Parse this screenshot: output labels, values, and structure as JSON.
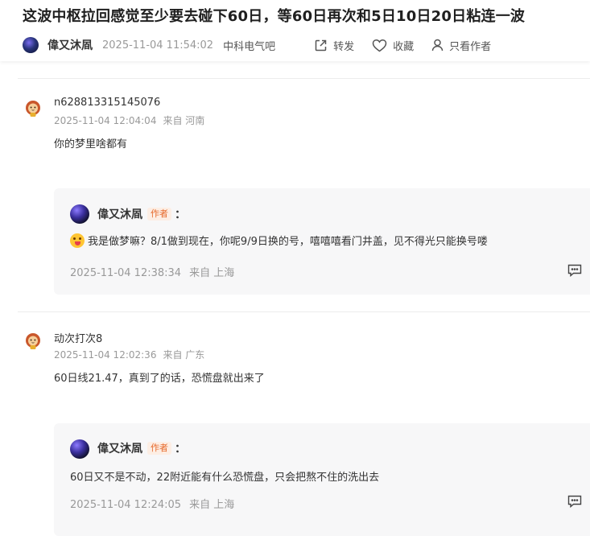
{
  "thread": {
    "title": "这波中枢拉回感觉至少要去碰下60日，等60日再次和5日10日20日粘连一波",
    "author": "偉又沐凮",
    "time": "2025-11-04 11:54:02",
    "forum": "中科电气吧",
    "actions": {
      "forward": "转发",
      "favorite": "收藏",
      "only_author": "只看作者"
    }
  },
  "posts": [
    {
      "user": "n628813315145076",
      "time": "2025-11-04 12:04:04",
      "location": "来自 河南",
      "content": "你的梦里啥都有",
      "reply": {
        "user": "偉又沐凮",
        "badge": "作者",
        "colon": "：",
        "content": "我是做梦嘛？8/1做到现在，你呢9/9日换的号，嘻嘻嘻看门井盖，见不得光只能换号喽",
        "time": "2025-11-04 12:38:34",
        "location": "来自 上海"
      }
    },
    {
      "user": "动次打次8",
      "time": "2025-11-04 12:02:36",
      "location": "来自 广东",
      "content": "60日线21.47，真到了的话，恐慌盘就出来了",
      "reply": {
        "user": "偉又沐凮",
        "badge": "作者",
        "colon": "：",
        "content": "60日又不是不动，22附近能有什么恐慌盘，只会把熬不住的洗出去",
        "time": "2025-11-04 12:24:05",
        "location": "来自 上海"
      }
    }
  ],
  "icons": {
    "forward": "forward-icon",
    "favorite": "heart-icon",
    "only_author": "person-icon",
    "reply_comment": "comment-icon",
    "user_avatar": "lion-mascot-avatar"
  }
}
